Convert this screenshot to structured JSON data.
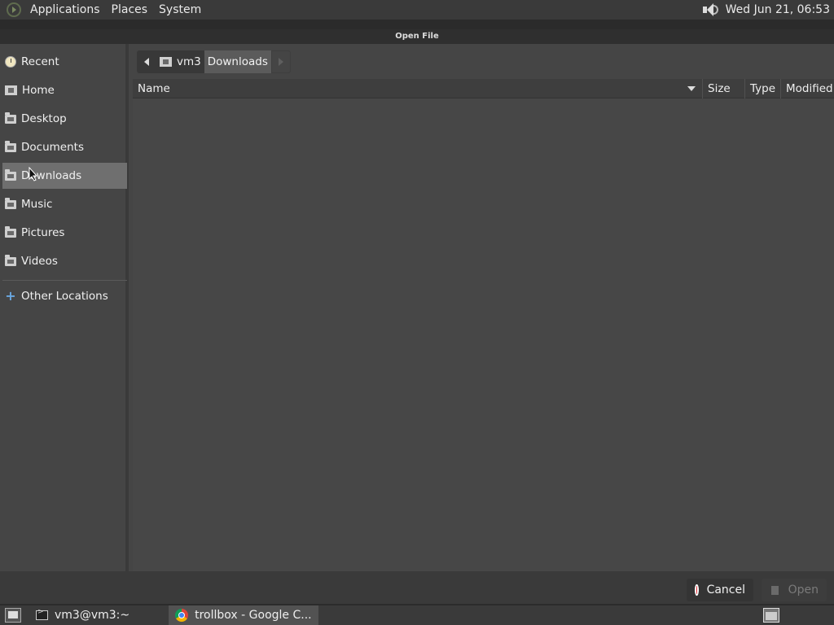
{
  "top_panel": {
    "menus": [
      "Applications",
      "Places",
      "System"
    ],
    "clock": "Wed Jun 21, 06:53"
  },
  "dialog": {
    "title": "Open File",
    "sidebar": {
      "items": [
        {
          "label": "Recent",
          "icon": "recent-icon"
        },
        {
          "label": "Home",
          "icon": "home-folder-icon"
        },
        {
          "label": "Desktop",
          "icon": "folder-icon"
        },
        {
          "label": "Documents",
          "icon": "folder-icon"
        },
        {
          "label": "Downloads",
          "icon": "folder-icon",
          "selected": true
        },
        {
          "label": "Music",
          "icon": "folder-icon"
        },
        {
          "label": "Pictures",
          "icon": "folder-icon"
        },
        {
          "label": "Videos",
          "icon": "folder-icon"
        }
      ],
      "other_locations": "Other Locations"
    },
    "pathbar": {
      "home_label": "vm3",
      "current_label": "Downloads"
    },
    "file_list": {
      "columns": [
        "Name",
        "Size",
        "Type",
        "Modified"
      ],
      "rows": []
    },
    "buttons": {
      "cancel": "Cancel",
      "open": "Open"
    }
  },
  "taskbar": {
    "tasks": [
      {
        "label": "vm3@vm3:~",
        "icon": "terminal-icon"
      },
      {
        "label": "trollbox - Google C...",
        "icon": "chrome-icon"
      }
    ]
  },
  "colors": {
    "selected_row": "#6f6f6f",
    "cancel_icon": "#e0202a"
  }
}
